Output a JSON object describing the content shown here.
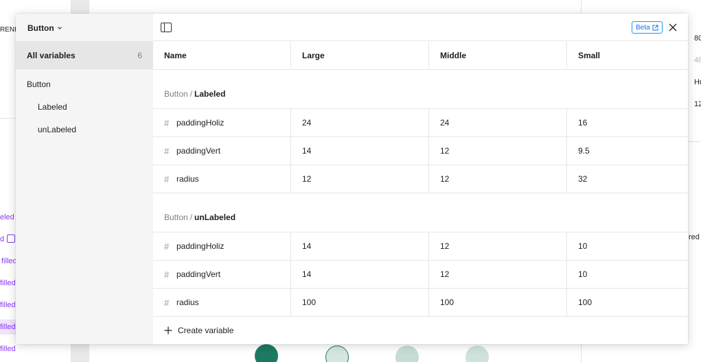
{
  "background": {
    "left_labels": [
      {
        "text": "RENI",
        "color": "dark"
      },
      {
        "text": "eled",
        "color": "purple"
      },
      {
        "text": "d",
        "color": "purple"
      },
      {
        "text": "filled",
        "color": "purple"
      },
      {
        "text": "filled",
        "color": "purple"
      },
      {
        "text": "filled",
        "color": "purple"
      },
      {
        "text": "filled",
        "color": "purple"
      },
      {
        "text": "filled",
        "color": "purple"
      }
    ],
    "right_labels": [
      "80",
      "48",
      "Hu",
      "12",
      "red"
    ]
  },
  "modal": {
    "collection": {
      "name": "Button"
    },
    "sidebar": {
      "all_variables": {
        "label": "All variables",
        "count": "6"
      },
      "groups": [
        {
          "label": "Button"
        },
        {
          "label": "Labeled"
        },
        {
          "label": "unLabeled"
        }
      ]
    },
    "beta_label": "Beta",
    "columns": [
      "Name",
      "Large",
      "Middle",
      "Small"
    ],
    "sections": [
      {
        "parent": "Button",
        "separator": "/",
        "child": "Labeled",
        "rows": [
          {
            "name": "paddingHoliz",
            "values": [
              "24",
              "24",
              "16"
            ]
          },
          {
            "name": "paddingVert",
            "values": [
              "14",
              "12",
              "9.5"
            ]
          },
          {
            "name": "radius",
            "values": [
              "12",
              "12",
              "32"
            ]
          }
        ]
      },
      {
        "parent": "Button",
        "separator": "/",
        "child": "unLabeled",
        "rows": [
          {
            "name": "paddingHoliz",
            "values": [
              "14",
              "12",
              "10"
            ]
          },
          {
            "name": "paddingVert",
            "values": [
              "14",
              "12",
              "10"
            ]
          },
          {
            "name": "radius",
            "values": [
              "100",
              "100",
              "100"
            ]
          }
        ]
      }
    ],
    "create_label": "Create variable"
  },
  "colors": {
    "accent": "#0d99ff",
    "brand_purple": "#8a38f5",
    "teal": "#1d7a62"
  }
}
